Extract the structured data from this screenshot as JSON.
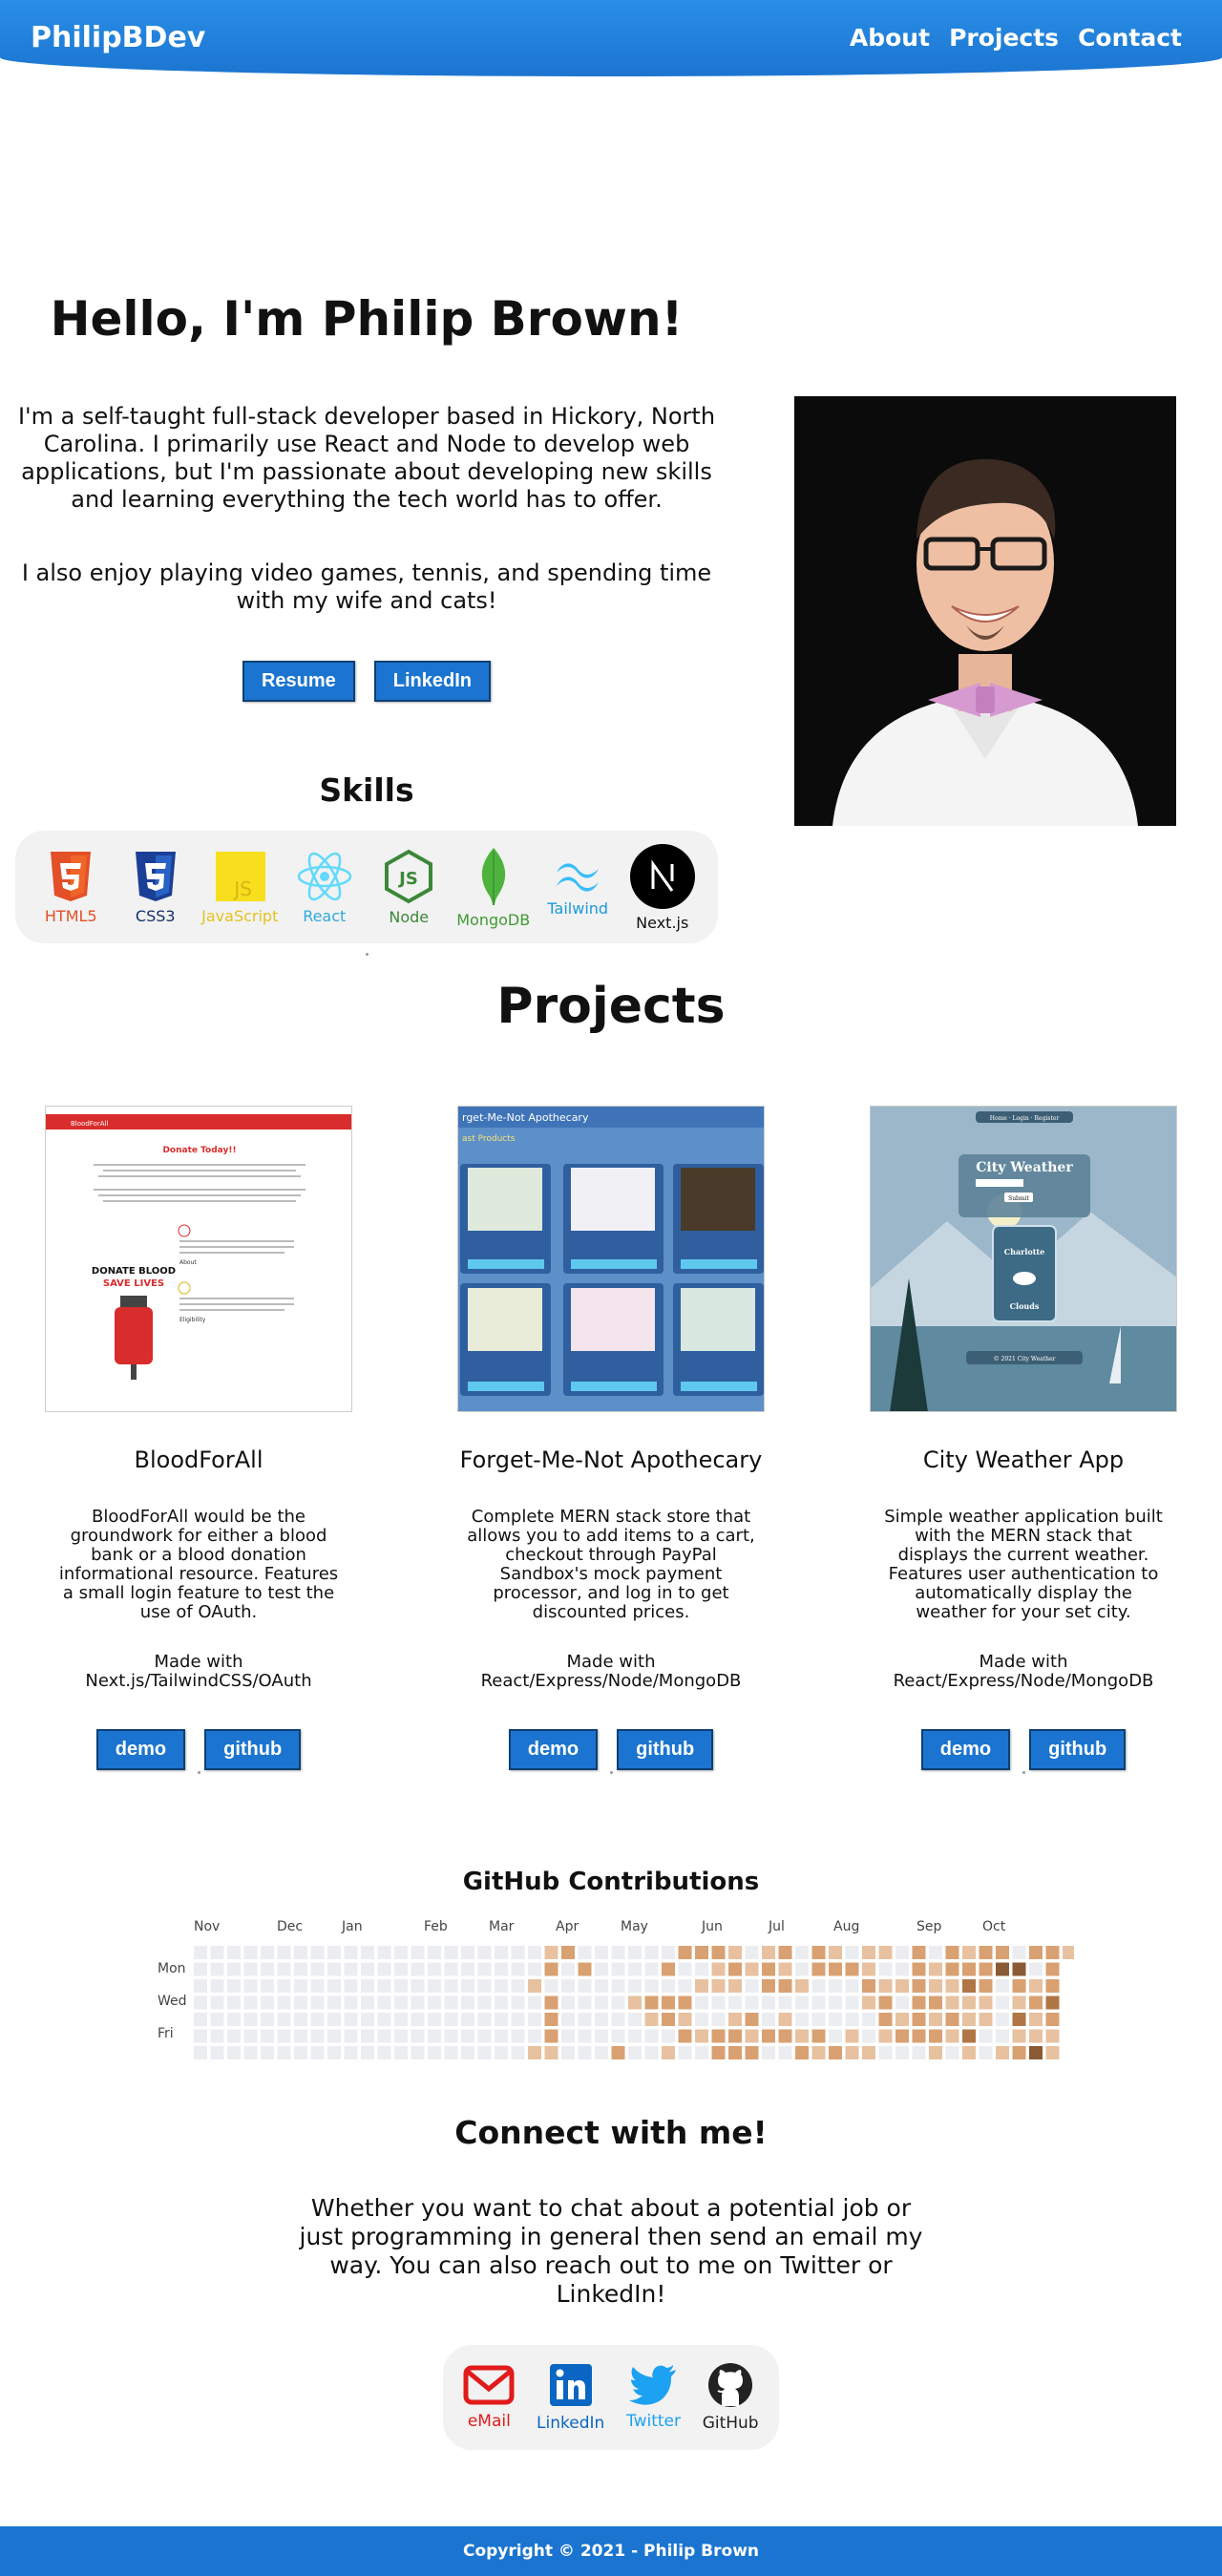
{
  "header": {
    "logo": "PhilipBDev",
    "nav": [
      "About",
      "Projects",
      "Contact"
    ]
  },
  "hero": {
    "title": "Hello, I'm Philip Brown!",
    "bio_1": "I'm a self-taught full-stack developer based in Hickory, North Carolina. I primarily use React and Node to develop web applications, but I'm passionate about developing new skills and learning everything the tech world has to offer.",
    "bio_2": "I also enjoy playing video games, tennis, and spending time with my wife and cats!",
    "resume_label": "Resume",
    "linkedin_label": "LinkedIn"
  },
  "skills": {
    "title": "Skills",
    "items": [
      {
        "label": "HTML5",
        "color": "#e34f26"
      },
      {
        "label": "CSS3",
        "color": "#264de4"
      },
      {
        "label": "JavaScript",
        "color": "#f0db4f"
      },
      {
        "label": "React",
        "color": "#61dafb"
      },
      {
        "label": "Node",
        "color": "#3c873a"
      },
      {
        "label": "MongoDB",
        "color": "#4db33d"
      },
      {
        "label": "Tailwind",
        "color": "#38bdf8"
      },
      {
        "label": "Next.js",
        "color": "#000000"
      }
    ]
  },
  "projects": {
    "title": "Projects",
    "items": [
      {
        "title": "BloodForAll",
        "description": "BloodForAll would be the groundwork for either a blood bank or a blood donation informational resource. Features a small login feature to test the use of OAuth.",
        "made_with": "Made with Next.js/TailwindCSS/OAuth",
        "demo_label": "demo",
        "github_label": "github",
        "screenshot": {
          "brand": "BloodForAll",
          "heading": "Donate Today!!",
          "banner_1": "DONATE BLOOD",
          "banner_2": "SAVE LIVES",
          "section_1": "About",
          "section_2": "Eligibility"
        }
      },
      {
        "title": "Forget-Me-Not Apothecary",
        "description": "Complete MERN stack store that allows you to add items to a cart, checkout through PayPal Sandbox's mock payment processor, and log in to get discounted prices.",
        "made_with": "Made with React/Express/Node/MongoDB",
        "demo_label": "demo",
        "github_label": "github",
        "screenshot": {
          "brand": "rget-Me-Not Apothecary",
          "section": "ast Products"
        }
      },
      {
        "title": "City Weather App",
        "description": "Simple weather application built with the MERN stack that displays the current weather. Features user authentication to automatically display the weather for your set city.",
        "made_with": "Made with React/Express/Node/MongoDB",
        "demo_label": "demo",
        "github_label": "github",
        "screenshot": {
          "nav": "Home · Login · Register",
          "heading": "City Weather",
          "button": "Submit",
          "city": "Charlotte",
          "condition": "Clouds",
          "footer": "© 2021      City Weather"
        }
      }
    ]
  },
  "contributions": {
    "title": "GitHub Contributions",
    "months": [
      "Nov",
      "Dec",
      "Jan",
      "Feb",
      "Mar",
      "Apr",
      "May",
      "Jun",
      "Jul",
      "Aug",
      "Sep",
      "Oct"
    ],
    "days": [
      "Mon",
      "Wed",
      "Fri"
    ],
    "colors": [
      "#ebedf0",
      "#e8c1a0",
      "#d9a071",
      "#b07646",
      "#8a5a35"
    ]
  },
  "connect": {
    "title": "Connect with me!",
    "text": "Whether you want to chat about a potential job or just programming in general then send an email my way. You can also reach out to me on Twitter or LinkedIn!",
    "items": [
      {
        "label": "eMail",
        "color": "#e21a1a"
      },
      {
        "label": "LinkedIn",
        "color": "#0a66c2"
      },
      {
        "label": "Twitter",
        "color": "#1da1f2"
      },
      {
        "label": "GitHub",
        "color": "#222222"
      }
    ]
  },
  "footer": {
    "copyright": "Copyright © 2021 - Philip Brown"
  }
}
